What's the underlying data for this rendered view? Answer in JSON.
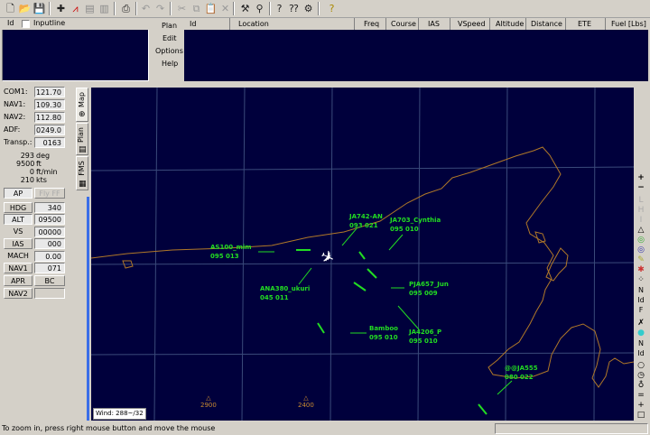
{
  "toolbar": {
    "icons": [
      "new-icon",
      "open-icon",
      "save-icon",
      "add-waypoint-icon",
      "waypoint-icon",
      "list-icon",
      "list2-icon",
      "print-icon",
      "undo-icon",
      "redo-icon",
      "cut-icon",
      "copy-icon",
      "paste-icon",
      "delete-icon",
      "hammer-icon",
      "connect-icon",
      "help-icon",
      "about-icon",
      "settings-icon",
      "question-icon"
    ]
  },
  "input_panel": {
    "id_label": "Id",
    "inputline_label": "Inputline"
  },
  "menu": [
    "Plan",
    "Edit",
    "Options",
    "Help"
  ],
  "flightplan": {
    "columns": [
      "Id",
      "Location",
      "Freq",
      "Course",
      "IAS",
      "VSpeed",
      "Altitude",
      "Distance",
      "ETE",
      "Fuel [Lbs]"
    ]
  },
  "radio": {
    "com1_label": "COM1:",
    "com1_value": "121.70",
    "nav1_label": "NAV1:",
    "nav1_value": "109.30",
    "nav2_label": "NAV2:",
    "nav2_value": "112.80",
    "adf_label": "ADF:",
    "adf_value": "0249.0",
    "transp_label": "Transp.:",
    "transp_value": "0163",
    "hdg": "293",
    "hdg_unit": "deg",
    "alt": "9500",
    "alt_unit": "ft",
    "vs": "0",
    "vs_unit": "ft/min",
    "spd": "210",
    "spd_unit": "kts"
  },
  "autopilot": {
    "ap_label": "AP",
    "flyff_label": "Fly FF",
    "hdg_label": "HDG",
    "hdg_value": "340",
    "alt_label": "ALT",
    "alt_value": "09500",
    "vs_label": "VS",
    "vs_value": "00000",
    "ias_label": "IAS",
    "ias_value": "000",
    "mach_label": "MACH",
    "mach_value": "0.00",
    "nav1_label": "NAV1",
    "nav1_value": "071",
    "apr_label": "APR",
    "bc_label": "BC",
    "nav2_label": "NAV2"
  },
  "tabs": [
    "Map",
    "Plan",
    "FMS"
  ],
  "map": {
    "wind": "Wind: 288~/32",
    "traffic": [
      {
        "callsign": "AS100_mim",
        "data": "095 013"
      },
      {
        "callsign": "JA742-AN",
        "data": "093 021"
      },
      {
        "callsign": "JA703_Cynthia",
        "data": "095 010"
      },
      {
        "callsign": "ANA380_ukuri",
        "data": "045 011"
      },
      {
        "callsign": "PJA657_Jun",
        "data": "095 009"
      },
      {
        "callsign": "Bamboo",
        "data": "095 010"
      },
      {
        "callsign": "JA4206_P",
        "data": "095 010"
      },
      {
        "callsign": "@@JA555",
        "data": "080 022"
      }
    ],
    "elevations": [
      "2900",
      "2400"
    ],
    "colors": {
      "traffic": "#22dd22",
      "coast": "#b07828",
      "grid": "#3a4a7a",
      "bg": "#00003c"
    }
  },
  "status_text": "To zoom in, press right mouse button and move the mouse"
}
